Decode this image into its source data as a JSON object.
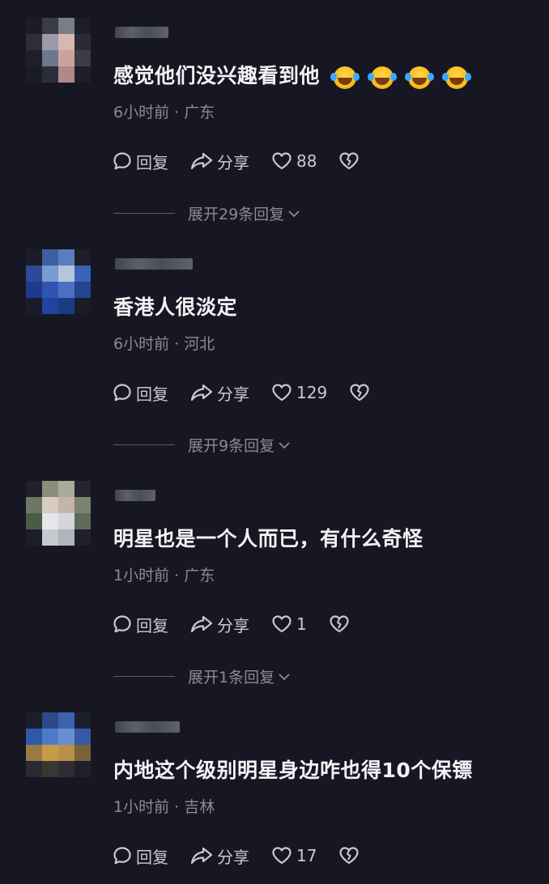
{
  "comments": [
    {
      "text": "感觉他们没兴趣看到他",
      "has_emojis": true,
      "emoji_names": [
        "laughing-crying-emoji",
        "laughing-crying-emoji",
        "laughing-crying-emoji",
        "laughing-crying-emoji"
      ],
      "time": "6小时前",
      "location": "广东",
      "meta": "6小时前 · 广东",
      "reply_label": "回复",
      "share_label": "分享",
      "likes": "88",
      "expand_label": "展开29条回复"
    },
    {
      "text": "香港人很淡定",
      "has_emojis": false,
      "time": "6小时前",
      "location": "河北",
      "meta": "6小时前 · 河北",
      "reply_label": "回复",
      "share_label": "分享",
      "likes": "129",
      "expand_label": "展开9条回复"
    },
    {
      "text": "明星也是一个人而已，有什么奇怪",
      "has_emojis": false,
      "time": "1小时前",
      "location": "广东",
      "meta": "1小时前 · 广东",
      "reply_label": "回复",
      "share_label": "分享",
      "likes": "1",
      "expand_label": "展开1条回复"
    },
    {
      "text": "内地这个级别明星身边咋也得10个保镖",
      "has_emojis": false,
      "time": "1小时前",
      "location": "吉林",
      "meta": "1小时前 · 吉林",
      "reply_label": "回复",
      "share_label": "分享",
      "likes": "17"
    }
  ],
  "colors": {
    "background": "#161722",
    "text": "#f3f3f5",
    "meta": "#8a8b94",
    "action": "#c9cad0"
  },
  "icons": {
    "reply": "comment-bubble-icon",
    "share": "share-arrow-icon",
    "like": "heart-icon",
    "dislike": "broken-heart-icon",
    "expand": "chevron-down-icon"
  }
}
